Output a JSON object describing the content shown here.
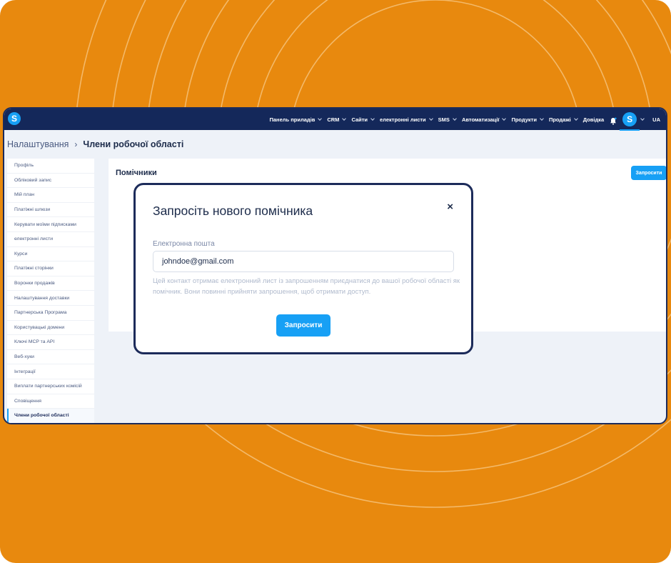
{
  "colors": {
    "background": "#e8890e",
    "nav": "#14285a",
    "accent": "#17a0f5",
    "window_border": "#1c2b5a"
  },
  "nav": {
    "logo_letter": "S",
    "items": [
      {
        "label": "Панель приладів"
      },
      {
        "label": "CRM"
      },
      {
        "label": "Сайти"
      },
      {
        "label": "електронні листи"
      },
      {
        "label": "SMS"
      },
      {
        "label": "Автоматизації"
      },
      {
        "label": "Продукти"
      },
      {
        "label": "Продажі"
      },
      {
        "label": "Довідка"
      }
    ],
    "avatar_letter": "S",
    "language": "UA"
  },
  "breadcrumb": {
    "parent": "Налаштування",
    "separator": "›",
    "current": "Члени робочої області"
  },
  "sidebar": {
    "items": [
      {
        "label": "Профіль",
        "active": false
      },
      {
        "label": "Обліковий запис",
        "active": false
      },
      {
        "label": "Мій план",
        "active": false
      },
      {
        "label": "Платіжні шлюзи",
        "active": false
      },
      {
        "label": "Керувати моїми підписками",
        "active": false
      },
      {
        "label": "електронні листи",
        "active": false
      },
      {
        "label": "Курси",
        "active": false
      },
      {
        "label": "Платіжні сторінки",
        "active": false
      },
      {
        "label": "Воронки продажів",
        "active": false
      },
      {
        "label": "Налаштування доставки",
        "active": false
      },
      {
        "label": "Партнерська Програма",
        "active": false
      },
      {
        "label": "Користувацькі домени",
        "active": false
      },
      {
        "label": "Ключі MCP та API",
        "active": false
      },
      {
        "label": "Веб-хуки",
        "active": false
      },
      {
        "label": "Інтеграції",
        "active": false
      },
      {
        "label": "Виплати партнерських комісій",
        "active": false
      },
      {
        "label": "Сповіщення",
        "active": false
      },
      {
        "label": "Члени робочої області",
        "active": true
      }
    ]
  },
  "main": {
    "title": "Помічники",
    "invite_button": "Запросити"
  },
  "modal": {
    "title": "Запросіть нового помічника",
    "close_icon": "×",
    "email_label": "Електронна пошта",
    "email_value": "johndoe@gmail.com",
    "hint": "Цей контакт отримає електронний лист із запрошенням приєднатися до вашої робочої області як помічник. Вони повинні прийняти запрошення, щоб отримати доступ.",
    "submit_label": "Запросити"
  }
}
